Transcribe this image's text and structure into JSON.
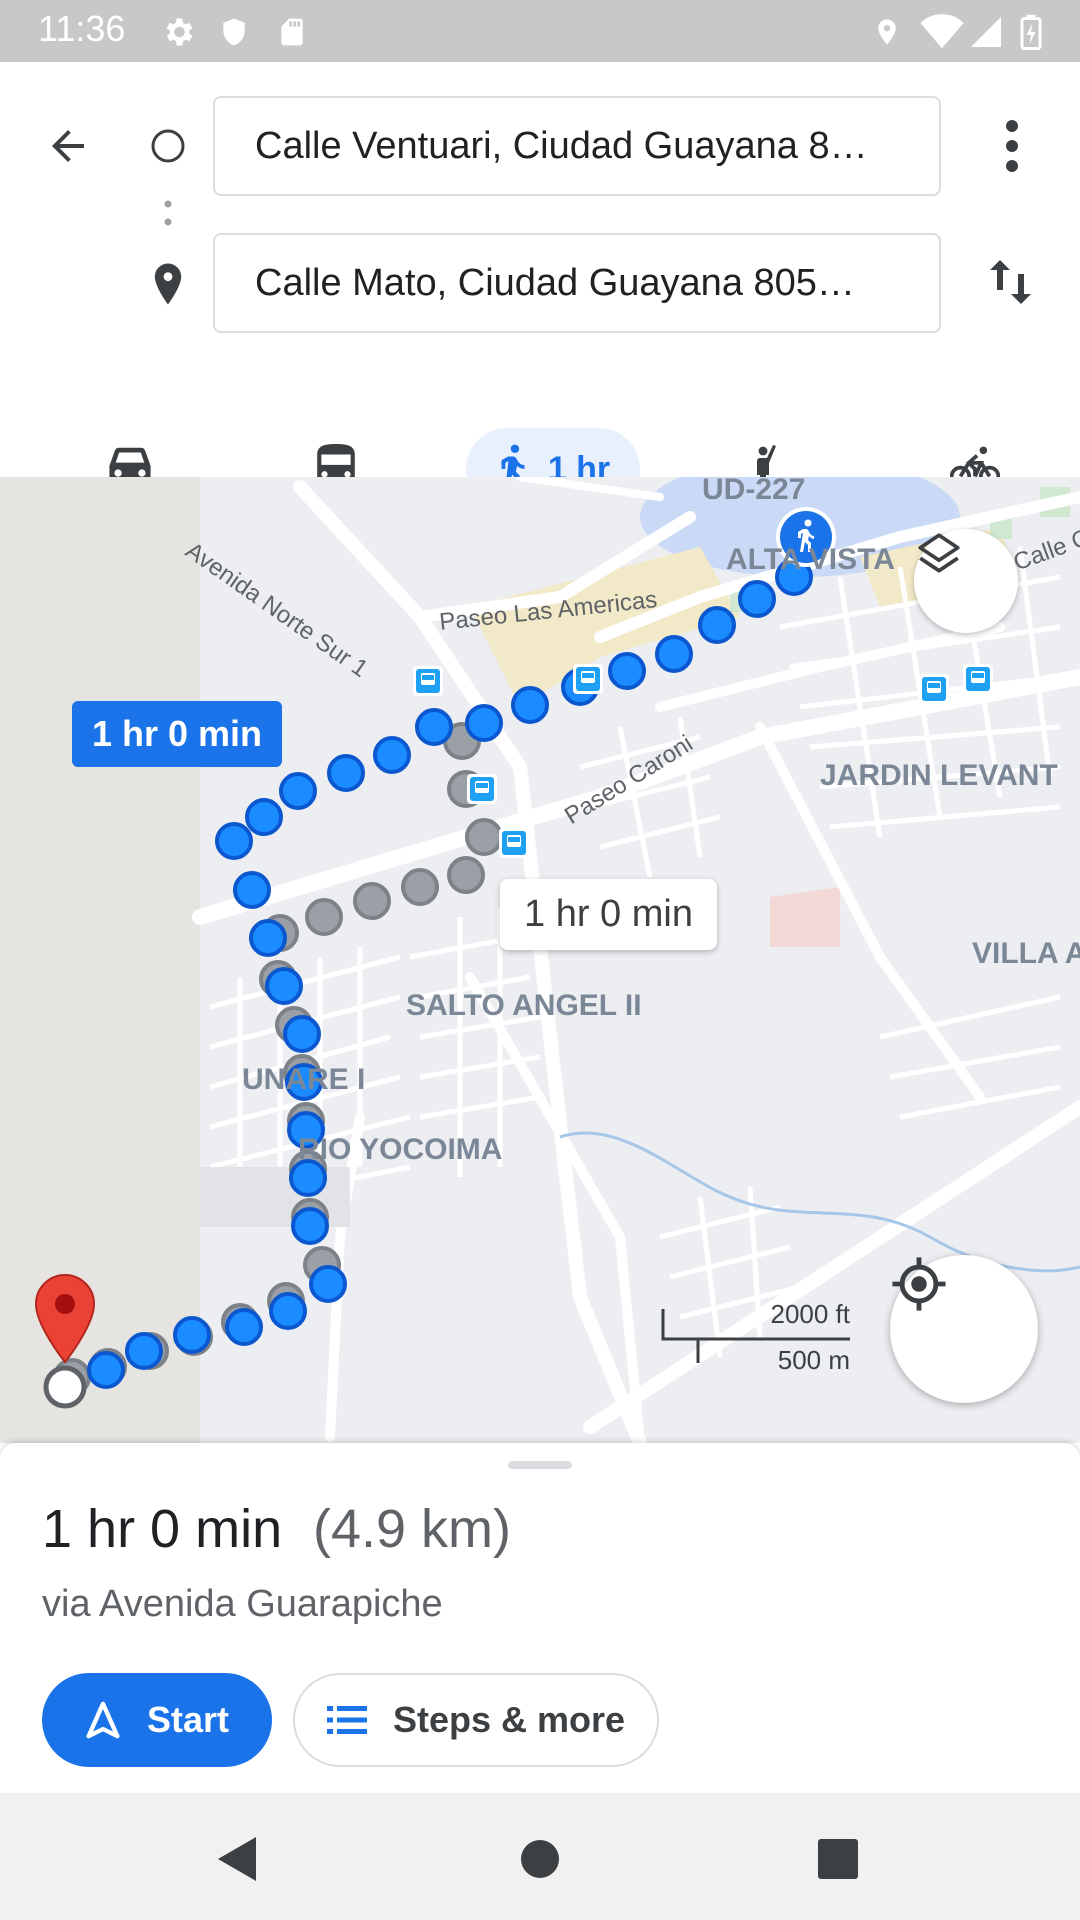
{
  "status_bar": {
    "time": "11:36",
    "icons": [
      "gear-icon",
      "shield-icon",
      "sd-card-icon",
      "location-pin-icon",
      "wifi-icon",
      "signal-icon",
      "battery-icon"
    ]
  },
  "directions": {
    "origin_value": "Calle Ventuari, Ciudad Guayana 8…",
    "destination_value": "Calle Mato, Ciudad Guayana 805…",
    "modes": [
      {
        "name": "driving",
        "icon": "car-icon"
      },
      {
        "name": "transit",
        "icon": "bus-icon"
      },
      {
        "name": "walking",
        "icon": "walk-icon",
        "label": "1 hr",
        "selected": true
      },
      {
        "name": "ride-hailing",
        "icon": "hail-icon"
      },
      {
        "name": "cycling",
        "icon": "bicycle-icon"
      }
    ]
  },
  "map": {
    "labels": {
      "alta_vista": "ALTA VISTA",
      "jardin_levante": "JARDIN LEVANT",
      "villa": "VILLA A",
      "salto_angel": "SALTO ANGEL II",
      "unare": "UNARE I",
      "rio_yocoima": "RIO YOCOIMA",
      "ud227": "UD-227"
    },
    "roads": {
      "norte_sur": "Avenida Norte Sur 1",
      "paseo_americas": "Paseo Las Americas",
      "paseo_caroni": "Paseo Caroni",
      "calle_c": "Calle C"
    },
    "primary_route_label": "1 hr 0 min",
    "alt_route_label": "1 hr 0 min",
    "scale_ft": "2000 ft",
    "scale_m": "500 m",
    "accent": "#1a73e8",
    "alt_route_color": "#9aa0a6",
    "destination_marker_color": "#ea4335"
  },
  "sheet": {
    "duration": "1 hr 0 min",
    "distance": "(4.9 km)",
    "via": "via Avenida Guarapiche",
    "start_label": "Start",
    "steps_label": "Steps & more"
  },
  "nav_bar": {
    "icons": [
      "back-triangle-icon",
      "home-circle-icon",
      "recents-square-icon"
    ]
  }
}
